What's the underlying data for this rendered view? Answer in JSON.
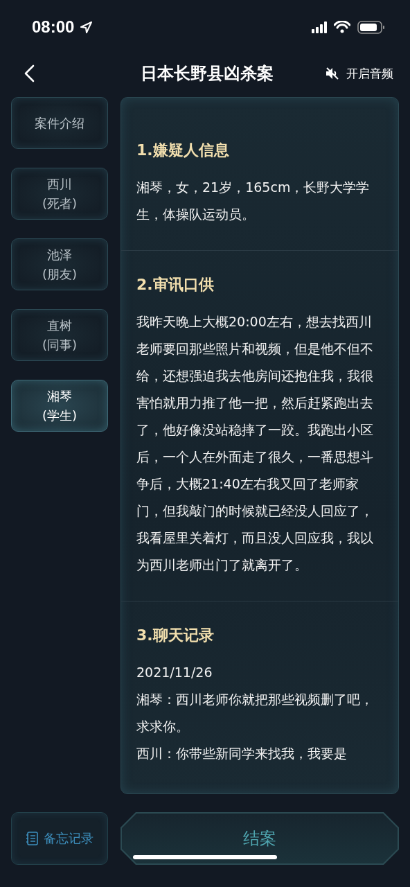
{
  "status_bar": {
    "time": "08:00"
  },
  "header": {
    "title": "日本长野县凶杀案",
    "audio_label": "开启音频",
    "audio_on": false
  },
  "sidebar": {
    "items": [
      {
        "name": "案件介绍",
        "selected": false
      },
      {
        "name": "西川",
        "role": "(死者)",
        "selected": false
      },
      {
        "name": "池泽",
        "role": "(朋友)",
        "selected": false
      },
      {
        "name": "直树",
        "role": "(同事)",
        "selected": false
      },
      {
        "name": "湘琴",
        "role": "(学生)",
        "selected": true
      }
    ]
  },
  "sections": [
    {
      "heading": "1.嫌疑人信息",
      "paragraphs": [
        "湘琴，女，21岁，165cm，长野大学学生，体操队运动员。"
      ]
    },
    {
      "heading": "2.审讯口供",
      "paragraphs": [
        "我昨天晚上大概20:00左右，想去找西川老师要回那些照片和视频，但是他不但不给，还想强迫我去他房间还抱住我，我很害怕就用力推了他一把，然后赶紧跑出去了，他好像没站稳摔了一跤。我跑出小区后，一个人在外面走了很久，一番思想斗争后，大概21:40左右我又回了老师家门，但我敲门的时候就已经没人回应了，我看屋里关着灯，而且没人回应我，我以为西川老师出门了就离开了。"
      ]
    },
    {
      "heading": "3.聊天记录",
      "paragraphs": [
        "2021/11/26",
        "湘琴：西川老师你就把那些视频删了吧，求求你。",
        "西川：你带些新同学来找我，我要是"
      ]
    }
  ],
  "bottom_bar": {
    "memo_label": "备忘记录",
    "close_label": "结案"
  }
}
